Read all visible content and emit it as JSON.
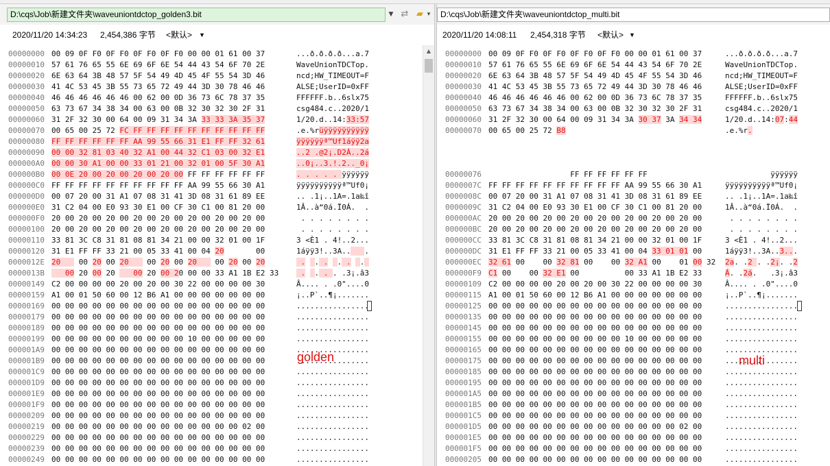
{
  "left": {
    "path": "D:\\cqs\\Job\\新建文件夹\\waveuniontdctop_golden3.bit",
    "datetime": "2020/11/20 14:34:23",
    "size": "2,454,386 字节",
    "encoding": "<默认>",
    "annotation": "golden",
    "rows": [
      {
        "off": "00000000",
        "hex": "00 09 0F F0 0F F0 0F F0 0F F0 00 00 01 61 00 37",
        "asc": "...ð.ð.ð.ð...a.7"
      },
      {
        "off": "00000010",
        "hex": "57 61 76 65 55 6E 69 6F 6E 54 44 43 54 6F 70 2E",
        "asc": "WaveUnionTDCTop."
      },
      {
        "off": "00000020",
        "hex": "6E 63 64 3B 48 57 5F 54 49 4D 45 4F 55 54 3D 46",
        "asc": "ncd;HW_TIMEOUT=F"
      },
      {
        "off": "00000030",
        "hex": "41 4C 53 45 3B 55 73 65 72 49 44 3D 30 78 46 46",
        "asc": "ALSE;UserID=0xFF"
      },
      {
        "off": "00000040",
        "hex": "46 46 46 46 46 46 00 62 00 0D 36 73 6C 78 37 35",
        "asc": "FFFFFF.b..6slx75"
      },
      {
        "off": "00000050",
        "hex": "63 73 67 34 38 34 00 63 00 0B 32 30 32 30 2F 31",
        "asc": "csg484.c..2020/1"
      },
      {
        "off": "00000060",
        "hex": "31 2F 32 30 00 64 00 09 31 34 3A 33 33 3A 35 37",
        "asc": "1/20.d..14:33:57",
        "hd": [
          [
            33,
            47
          ]
        ],
        "ad": [
          [
            11,
            16
          ]
        ]
      },
      {
        "off": "00000070",
        "hex": "00 65 00 25 72 FC FF FF FF FF FF FF FF FF FF FF",
        "asc": ".e.%rüÿÿÿÿÿÿÿÿÿÿ",
        "hd": [
          [
            15,
            47
          ]
        ],
        "ad": [
          [
            5,
            16
          ]
        ]
      },
      {
        "off": "00000080",
        "hex": "FF FF FF FF FF FF AA 99 55 66 31 E1 FF FF 32 61",
        "asc": "ÿÿÿÿÿÿª™Uf1áÿÿ2a",
        "hd": [
          [
            0,
            47
          ]
        ],
        "ad": [
          [
            0,
            16
          ]
        ]
      },
      {
        "off": "00000090",
        "hex": "00 00 32 81 03 40 32 A1 00 44 32 C1 03 00 32 E1",
        "asc": "..2 .@2¡.D2Á..2á",
        "hd": [
          [
            0,
            47
          ]
        ],
        "ad": [
          [
            0,
            16
          ]
        ]
      },
      {
        "off": "000000A0",
        "hex": "00 00 30 A1 00 00 33 01 21 00 32 01 00 5F 30 A1",
        "asc": "..0¡..3.!.2.._0¡",
        "hd": [
          [
            0,
            47
          ]
        ],
        "ad": [
          [
            0,
            16
          ]
        ]
      },
      {
        "off": "000000B0",
        "hex": "00 0E 20 00 20 00 20 00 20 00 FF FF FF FF FF FF",
        "asc": ". . . . . ÿÿÿÿÿÿ",
        "hd": [
          [
            0,
            29
          ]
        ],
        "ad": [
          [
            0,
            10
          ]
        ]
      },
      {
        "off": "000000C0",
        "hex": "FF FF FF FF FF FF FF FF FF FF AA 99 55 66 30 A1",
        "asc": "ÿÿÿÿÿÿÿÿÿÿª™Uf0¡"
      },
      {
        "off": "000000D0",
        "hex": "00 07 20 00 31 A1 07 08 31 41 3D 08 31 61 89 EE",
        "asc": ".. .1¡..1A=.1a‰î"
      },
      {
        "off": "000000E0",
        "hex": "31 C2 04 00 E0 93 30 E1 00 CF 30 C1 00 81 20 00",
        "asc": "1Â..à“0á.Ï0Á.  ."
      },
      {
        "off": "000000F0",
        "hex": "20 00 20 00 20 00 20 00 20 00 20 00 20 00 20 00",
        "asc": " . . . . . . . ."
      },
      {
        "off": "00000100",
        "hex": "20 00 20 00 20 00 20 00 20 00 20 00 20 00 20 00",
        "asc": " . . . . . . . ."
      },
      {
        "off": "00000110",
        "hex": "33 81 3C C8 31 81 08 81 34 21 00 00 32 01 00 1F",
        "asc": "3 <È1 . 4!..2..."
      },
      {
        "off": "00000120",
        "hex": "31 E1 FF FF 33 21 00 05 33 41 00 04 20       00",
        "asc": "1áÿÿ3!..3A..   .",
        "hd": [
          [
            36,
            38
          ]
        ],
        "ad": [
          [
            12,
            15
          ]
        ]
      },
      {
        "off": "0000012E",
        "hex": "20    00 20 00 20    00 20 00 20    00 20 00 20",
        "asc": " .  . .  . .  . ",
        "hd": [
          [
            0,
            5
          ],
          [
            9,
            11
          ],
          [
            15,
            20
          ],
          [
            24,
            26
          ],
          [
            30,
            35
          ],
          [
            39,
            41
          ],
          [
            45,
            47
          ]
        ],
        "ad": [
          [
            0,
            2
          ],
          [
            3,
            4
          ],
          [
            5,
            7
          ],
          [
            8,
            9
          ],
          [
            10,
            12
          ],
          [
            13,
            14
          ],
          [
            15,
            16
          ]
        ]
      },
      {
        "off": "0000013B",
        "hex": "   00 20 00 20    00 20 00 20 00 00 33 A1 1B E2 33",
        "asc": " .  . . . .3¡.â3",
        "hd": [
          [
            0,
            5
          ],
          [
            9,
            11
          ],
          [
            15,
            20
          ],
          [
            24,
            28
          ]
        ],
        "ad": [
          [
            0,
            2
          ],
          [
            3,
            4
          ],
          [
            5,
            8
          ]
        ]
      },
      {
        "off": "00000149",
        "hex": "C2 00 00 00 00 20 00 20 00 30 22 00 00 00 00 30",
        "asc": "Â.... . .0\"....0"
      },
      {
        "off": "00000159",
        "hex": "A1 00 01 50 60 00 12 B6 A1 00 00 00 00 00 00 00",
        "asc": "¡..P`..¶¡......."
      },
      {
        "off": "00000169",
        "hex": "00 00 00 00 00 00 00 00 00 00 00 00 00 00 00 00",
        "asc": "................",
        "cur": true
      },
      {
        "off": "00000179",
        "hex": "00 00 00 00 00 00 00 00 00 00 00 00 00 00 00 00",
        "asc": "................"
      },
      {
        "off": "00000189",
        "hex": "00 00 00 00 00 00 00 00 00 00 00 00 00 00 00 00",
        "asc": "................"
      },
      {
        "off": "00000199",
        "hex": "00 00 00 00 00 00 00 00 00 00 10 00 00 00 00 00",
        "asc": "................"
      },
      {
        "off": "000001A9",
        "hex": "00 00 00 00 00 00 00 00 00 00 00 00 00 00 00 00",
        "asc": "................"
      },
      {
        "off": "000001B9",
        "hex": "00 00 00 00 00 00 00 00 00 00 00 00 00 00 00 00",
        "asc": "................"
      },
      {
        "off": "000001C9",
        "hex": "00 00 00 00 00 00 00 00 00 00 00 00 00 00 00 00",
        "asc": "................"
      },
      {
        "off": "000001D9",
        "hex": "00 00 00 00 00 00 00 00 00 00 00 00 00 00 00 00",
        "asc": "................"
      },
      {
        "off": "000001E9",
        "hex": "00 00 00 00 00 00 00 00 00 00 00 00 00 00 00 00",
        "asc": "................"
      },
      {
        "off": "000001F9",
        "hex": "00 00 00 00 00 00 00 00 00 00 00 00 00 00 00 00",
        "asc": "................"
      },
      {
        "off": "00000209",
        "hex": "00 00 00 00 00 00 00 00 00 00 00 00 00 00 00 00",
        "asc": "................"
      },
      {
        "off": "00000219",
        "hex": "00 00 00 00 00 00 00 00 00 00 00 00 00 00 02 00",
        "asc": "................"
      },
      {
        "off": "00000229",
        "hex": "00 00 00 00 00 00 00 00 00 00 00 00 00 00 00 00",
        "asc": "................"
      },
      {
        "off": "00000239",
        "hex": "00 00 00 00 00 00 00 00 00 00 00 00 00 00 00 00",
        "asc": "................"
      },
      {
        "off": "00000249",
        "hex": "00 00 00 00 00 00 00 00 00 00 00 00 00 00 00 00",
        "asc": "................"
      }
    ]
  },
  "right": {
    "path": "D:\\cqs\\Job\\新建文件夹\\waveuniontdctop_multi.bit",
    "datetime": "2020/11/20 14:08:11",
    "size": "2,454,318 字节",
    "encoding": "<默认>",
    "annotation": "multi",
    "rows": [
      {
        "off": "00000000",
        "hex": "00 09 0F F0 0F F0 0F F0 0F F0 00 00 01 61 00 37",
        "asc": "...ð.ð.ð.ð...a.7"
      },
      {
        "off": "00000010",
        "hex": "57 61 76 65 55 6E 69 6F 6E 54 44 43 54 6F 70 2E",
        "asc": "WaveUnionTDCTop."
      },
      {
        "off": "00000020",
        "hex": "6E 63 64 3B 48 57 5F 54 49 4D 45 4F 55 54 3D 46",
        "asc": "ncd;HW_TIMEOUT=F"
      },
      {
        "off": "00000030",
        "hex": "41 4C 53 45 3B 55 73 65 72 49 44 3D 30 78 46 46",
        "asc": "ALSE;UserID=0xFF"
      },
      {
        "off": "00000040",
        "hex": "46 46 46 46 46 46 00 62 00 0D 36 73 6C 78 37 35",
        "asc": "FFFFFF.b..6slx75"
      },
      {
        "off": "00000050",
        "hex": "63 73 67 34 38 34 00 63 00 0B 32 30 32 30 2F 31",
        "asc": "csg484.c..2020/1"
      },
      {
        "off": "00000060",
        "hex": "31 2F 32 30 00 64 00 09 31 34 3A 30 37 3A 34 34",
        "asc": "1/20.d..14:07:44",
        "hd": [
          [
            33,
            38
          ],
          [
            42,
            47
          ]
        ],
        "ad": [
          [
            11,
            13
          ],
          [
            14,
            16
          ]
        ]
      },
      {
        "off": "00000070",
        "hex": "00 65 00 25 72 B8",
        "asc": ".e.%r.",
        "hd": [
          [
            15,
            17
          ]
        ],
        "ad": [
          [
            5,
            6
          ]
        ]
      },
      {
        "off": "",
        "hex": "",
        "asc": ""
      },
      {
        "off": "",
        "hex": "",
        "asc": ""
      },
      {
        "off": "",
        "hex": "",
        "asc": ""
      },
      {
        "off": "00000076",
        "hex": "                  FF FF FF FF FF FF",
        "asc": "          ÿÿÿÿÿÿ"
      },
      {
        "off": "0000007C",
        "hex": "FF FF FF FF FF FF FF FF FF FF AA 99 55 66 30 A1",
        "asc": "ÿÿÿÿÿÿÿÿÿÿª™Uf0¡"
      },
      {
        "off": "0000008C",
        "hex": "00 07 20 00 31 A1 07 08 31 41 3D 08 31 61 89 EE",
        "asc": ".. .1¡..1A=.1a‰î"
      },
      {
        "off": "0000009C",
        "hex": "31 C2 04 00 E0 93 30 E1 00 CF 30 C1 00 81 20 00",
        "asc": "1Â..à“0á.Ï0Á.  ."
      },
      {
        "off": "000000AC",
        "hex": "20 00 20 00 20 00 20 00 20 00 20 00 20 00 20 00",
        "asc": " . . . . . . . ."
      },
      {
        "off": "000000BC",
        "hex": "20 00 20 00 20 00 20 00 20 00 20 00 20 00 20 00",
        "asc": " . . . . . . . ."
      },
      {
        "off": "000000CC",
        "hex": "33 81 3C C8 31 81 08 81 34 21 00 00 32 01 00 1F",
        "asc": "3 <È1 . 4!..2..."
      },
      {
        "off": "000000DC",
        "hex": "31 E1 FF FF 33 21 00 05 33 41 00 04 33 01 01 00",
        "asc": "1áÿÿ3!..3A..3...",
        "hd": [
          [
            36,
            44
          ]
        ],
        "ad": [
          [
            12,
            15
          ]
        ]
      },
      {
        "off": "000000EC",
        "hex": "32 61 00    00 32 81 00    00 32 A1 00    01 00 32",
        "asc": "2a. .2 . .2¡. .2",
        "hd": [
          [
            0,
            5
          ],
          [
            15,
            20
          ],
          [
            30,
            35
          ],
          [
            45,
            47
          ]
        ],
        "ad": [
          [
            0,
            2
          ],
          [
            5,
            7
          ],
          [
            10,
            12
          ],
          [
            15,
            16
          ]
        ]
      },
      {
        "off": "000000F9",
        "hex": "C1 00    00 32 E1 00          00 33 A1 1B E2 33",
        "asc": "Á. .2á.   .3¡.â3",
        "hd": [
          [
            0,
            2
          ],
          [
            12,
            17
          ]
        ],
        "ad": [
          [
            0,
            1
          ],
          [
            4,
            6
          ]
        ]
      },
      {
        "off": "00000109",
        "hex": "C2 00 00 00 00 20 00 20 00 30 22 00 00 00 00 30",
        "asc": "Â.... . .0\"....0"
      },
      {
        "off": "00000115",
        "hex": "A1 00 01 50 60 00 12 B6 A1 00 00 00 00 00 00 00",
        "asc": "¡..P`..¶¡......."
      },
      {
        "off": "00000125",
        "hex": "00 00 00 00 00 00 00 00 00 00 00 00 00 00 00 00",
        "asc": "................",
        "cur": true
      },
      {
        "off": "00000135",
        "hex": "00 00 00 00 00 00 00 00 00 00 00 00 00 00 00 00",
        "asc": "................"
      },
      {
        "off": "00000145",
        "hex": "00 00 00 00 00 00 00 00 00 00 00 00 00 00 00 00",
        "asc": "................"
      },
      {
        "off": "00000155",
        "hex": "00 00 00 00 00 00 00 00 00 00 10 00 00 00 00 00",
        "asc": "................"
      },
      {
        "off": "00000165",
        "hex": "00 00 00 00 00 00 00 00 00 00 00 00 00 00 00 00",
        "asc": "................"
      },
      {
        "off": "00000175",
        "hex": "00 00 00 00 00 00 00 00 00 00 00 00 00 00 00 00",
        "asc": "................"
      },
      {
        "off": "00000185",
        "hex": "00 00 00 00 00 00 00 00 00 00 00 00 00 00 00 00",
        "asc": "................"
      },
      {
        "off": "00000195",
        "hex": "00 00 00 00 00 00 00 00 00 00 00 00 00 00 00 00",
        "asc": "................"
      },
      {
        "off": "000001A5",
        "hex": "00 00 00 00 00 00 00 00 00 00 00 00 00 00 00 00",
        "asc": "................"
      },
      {
        "off": "000001B5",
        "hex": "00 00 00 00 00 00 00 00 00 00 00 00 00 00 00 00",
        "asc": "................"
      },
      {
        "off": "000001C5",
        "hex": "00 00 00 00 00 00 00 00 00 00 00 00 00 00 00 00",
        "asc": "................"
      },
      {
        "off": "000001D5",
        "hex": "00 00 00 00 00 00 00 00 00 00 00 00 00 00 02 00",
        "asc": "................"
      },
      {
        "off": "000001E5",
        "hex": "00 00 00 00 00 00 00 00 00 00 00 00 00 00 00 00",
        "asc": "................"
      },
      {
        "off": "000001F5",
        "hex": "00 00 00 00 00 00 00 00 00 00 00 00 00 00 00 00",
        "asc": "................"
      },
      {
        "off": "00000205",
        "hex": "00 00 00 00 00 00 00 00 00 00 00 00 00 00 00 00",
        "asc": "................"
      }
    ]
  },
  "icons": {
    "dropdown": "chevron-down-icon",
    "sync": "sync-icon",
    "folder": "folder-open-icon"
  },
  "colors": {
    "diff_fg": "#e01010",
    "diff_bg": "#ffd7d7",
    "path_bg": "#ddf5dd"
  }
}
